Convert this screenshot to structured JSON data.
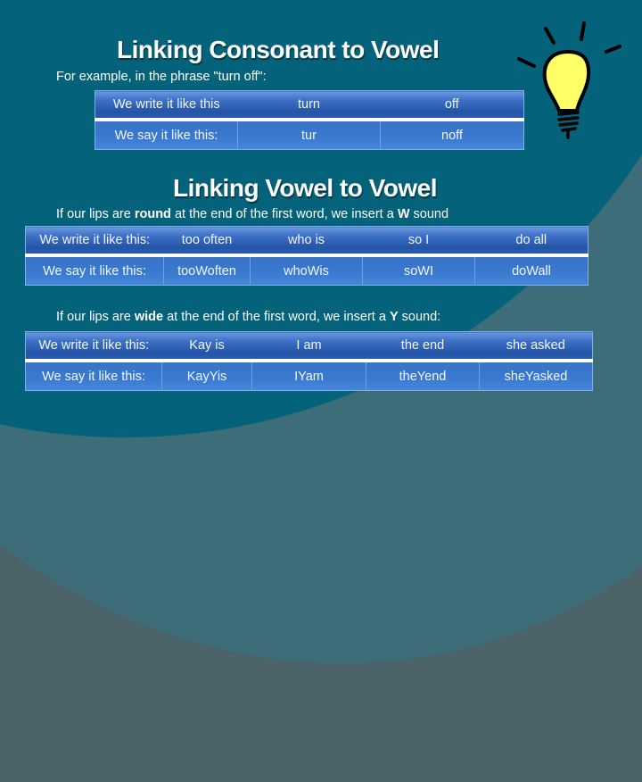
{
  "section1": {
    "title": "Linking Consonant to Vowel",
    "caption": "For example, in the phrase \"turn off\":",
    "table": {
      "header": [
        "We write it like this",
        "turn",
        "off"
      ],
      "row": [
        "We say it like this:",
        "tur",
        "noff"
      ]
    }
  },
  "section2": {
    "title": "Linking Vowel to Vowel",
    "caption_round": {
      "pre": "If our lips are ",
      "bold1": "round",
      "mid": " at the end of the first word, we insert a ",
      "bold2": "W",
      "post": " sound"
    },
    "table_w": {
      "header": [
        "We write it like this:",
        "too often",
        "who is",
        "so I",
        "do all"
      ],
      "row": [
        "We say it like this:",
        "tooWoften",
        "whoWis",
        "soWI",
        "doWall"
      ]
    },
    "caption_wide": {
      "pre": "If our lips are ",
      "bold1": "wide",
      "mid": " at the end of the first word, we insert a ",
      "bold2": "Y",
      "post": " sound:"
    },
    "table_y": {
      "header": [
        "We write it like this:",
        "Kay is",
        "I am",
        "the end",
        "she asked"
      ],
      "row": [
        "We say it like this:",
        "KayYis",
        "IYam",
        "theYend",
        "sheYasked"
      ]
    }
  },
  "decoration": {
    "icon": "lightbulb-icon",
    "bulb_color": "#ffff66",
    "background_color": "#04627a",
    "table_accent": "#2a5db0"
  }
}
